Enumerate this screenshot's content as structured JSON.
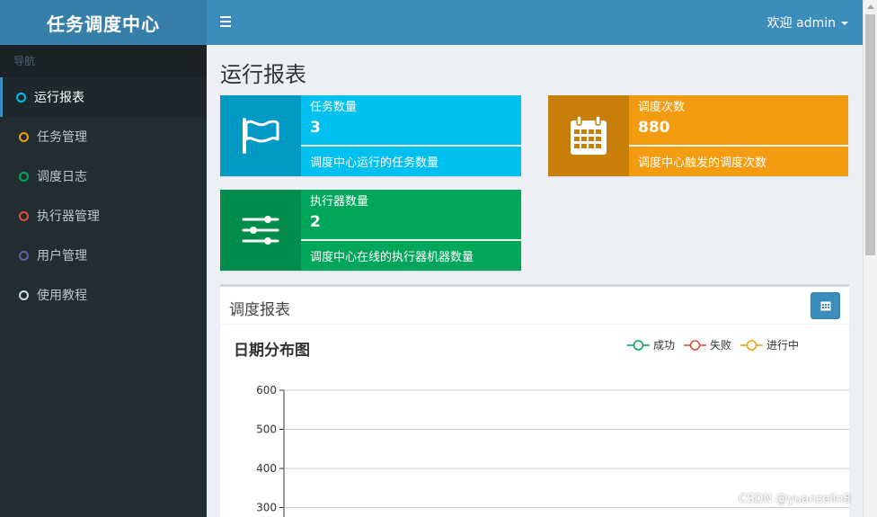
{
  "app": {
    "brand": "任务调度中心"
  },
  "topbar": {
    "user_label": "欢迎 admin"
  },
  "sidebar": {
    "header": "导航",
    "items": [
      {
        "label": "运行报表",
        "color": "#00c0ef",
        "active": true
      },
      {
        "label": "任务管理",
        "color": "#f39c12"
      },
      {
        "label": "调度日志",
        "color": "#00a65a"
      },
      {
        "label": "执行器管理",
        "color": "#dd4b39"
      },
      {
        "label": "用户管理",
        "color": "#605ca8"
      },
      {
        "label": "使用教程",
        "color": "#d2d6de"
      }
    ]
  },
  "page": {
    "title": "运行报表"
  },
  "stats": [
    {
      "label": "任务数量",
      "value": "3",
      "desc": "调度中心运行的任务数量",
      "icon": "flag-icon"
    },
    {
      "label": "调度次数",
      "value": "880",
      "desc": "调度中心触发的调度次数",
      "icon": "calendar-icon"
    },
    {
      "label": "执行器数量",
      "value": "2",
      "desc": "调度中心在线的执行器机器数量",
      "icon": "sliders-icon"
    }
  ],
  "report": {
    "title": "调度报表"
  },
  "chart_data": {
    "type": "line",
    "title": "日期分布图",
    "series": [
      {
        "name": "成功",
        "color": "#00a65a",
        "values": []
      },
      {
        "name": "失败",
        "color": "#dd4b39",
        "values": []
      },
      {
        "name": "进行中",
        "color": "#f39c12",
        "values": []
      }
    ],
    "yticks": [
      600,
      500,
      400,
      300
    ],
    "ylabel": "",
    "xlabel": ""
  },
  "watermark": "CSDN @yuanzelin8"
}
